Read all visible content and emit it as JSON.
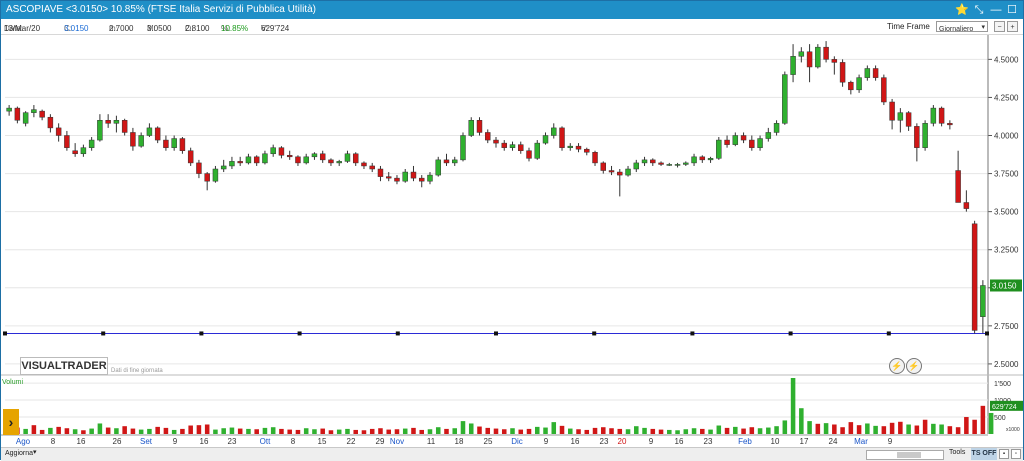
{
  "window": {
    "title": "ASCOPIAVE <3.0150> 10.85%  (FTSE Italia Servizi di Pubblica Utilità)",
    "pin_icon": "star-icon",
    "controls": [
      "⭐",
      "⤡",
      "—",
      "☐",
      "✕"
    ]
  },
  "info": {
    "date_label": "Data:",
    "date": "13/Mar/20",
    "close_label": "C:",
    "close": "3.0150",
    "min_label": "m:",
    "min": "2.7000",
    "max_label": "M:",
    "max": "3.0500",
    "open_label": "O:",
    "open": "2.8100",
    "pct_label": "%:",
    "pct": "10.85%",
    "vol_label": "V:",
    "vol": "629'724",
    "timeframe_label": "Time Frame",
    "timeframe_value": "Giornaliero"
  },
  "chart": {
    "brand": "VISUALTRADER",
    "eod_note": "Dati di fine giornata",
    "volume_label": "Volumi",
    "current_price_label": "3.0150",
    "current_volume_label": "629'724",
    "vol_scale_unit": "x1000",
    "colors": {
      "up": "#2fb02f",
      "down": "#d01616",
      "hline": "#2b2bd6",
      "grid": "#e6e6e6"
    }
  },
  "chart_data": {
    "type": "candlestick",
    "title": "ASCOPIAVE",
    "y_ticks": [
      "4.5000",
      "4.2500",
      "4.0000",
      "3.7500",
      "3.5000",
      "3.2500",
      "3.0000",
      "2.7500",
      "2.5000"
    ],
    "ylim": [
      2.46,
      4.66
    ],
    "horizontal_line": 2.7,
    "vol_ticks": [
      "1'500",
      "1'000",
      "500"
    ],
    "vol_ylim": [
      0,
      1650
    ],
    "x_ticks": [
      {
        "label": "Ago",
        "month": true
      },
      {
        "label": "8"
      },
      {
        "label": "16"
      },
      {
        "label": "26"
      },
      {
        "label": "Set",
        "month": true
      },
      {
        "label": "9"
      },
      {
        "label": "16"
      },
      {
        "label": "23"
      },
      {
        "label": "Ott",
        "month": true
      },
      {
        "label": "8"
      },
      {
        "label": "15"
      },
      {
        "label": "22"
      },
      {
        "label": "29"
      },
      {
        "label": "Nov",
        "month": true
      },
      {
        "label": "11"
      },
      {
        "label": "18"
      },
      {
        "label": "25"
      },
      {
        "label": "Dic",
        "month": true
      },
      {
        "label": "9"
      },
      {
        "label": "16"
      },
      {
        "label": "23"
      },
      {
        "label": "20",
        "red": true
      },
      {
        "label": "9"
      },
      {
        "label": "16"
      },
      {
        "label": "23"
      },
      {
        "label": "Feb",
        "month": true
      },
      {
        "label": "10"
      },
      {
        "label": "17"
      },
      {
        "label": "24"
      },
      {
        "label": "Mar",
        "month": true
      },
      {
        "label": "9"
      }
    ],
    "candles": [
      [
        4.16,
        4.2,
        4.13,
        4.18
      ],
      [
        4.18,
        4.19,
        4.08,
        4.1
      ],
      [
        4.08,
        4.16,
        4.06,
        4.15
      ],
      [
        4.15,
        4.2,
        4.12,
        4.17
      ],
      [
        4.16,
        4.17,
        4.1,
        4.12
      ],
      [
        4.12,
        4.14,
        4.02,
        4.05
      ],
      [
        4.05,
        4.08,
        3.96,
        4.0
      ],
      [
        4.0,
        4.03,
        3.9,
        3.92
      ],
      [
        3.9,
        3.95,
        3.86,
        3.88
      ],
      [
        3.88,
        3.94,
        3.86,
        3.92
      ],
      [
        3.92,
        3.99,
        3.9,
        3.97
      ],
      [
        3.97,
        4.14,
        3.96,
        4.1
      ],
      [
        4.1,
        4.14,
        4.05,
        4.08
      ],
      [
        4.08,
        4.13,
        4.02,
        4.1
      ],
      [
        4.1,
        4.11,
        4.0,
        4.02
      ],
      [
        4.02,
        4.05,
        3.9,
        3.93
      ],
      [
        3.93,
        4.02,
        3.92,
        4.0
      ],
      [
        4.0,
        4.08,
        3.99,
        4.05
      ],
      [
        4.05,
        4.06,
        3.95,
        3.97
      ],
      [
        3.97,
        4.0,
        3.9,
        3.92
      ],
      [
        3.92,
        4.0,
        3.9,
        3.98
      ],
      [
        3.98,
        3.99,
        3.88,
        3.9
      ],
      [
        3.9,
        3.92,
        3.8,
        3.82
      ],
      [
        3.82,
        3.84,
        3.72,
        3.75
      ],
      [
        3.75,
        3.76,
        3.64,
        3.7
      ],
      [
        3.7,
        3.8,
        3.69,
        3.78
      ],
      [
        3.78,
        3.84,
        3.76,
        3.8
      ],
      [
        3.8,
        3.86,
        3.78,
        3.83
      ],
      [
        3.83,
        3.86,
        3.8,
        3.82
      ],
      [
        3.82,
        3.88,
        3.81,
        3.86
      ],
      [
        3.86,
        3.87,
        3.8,
        3.82
      ],
      [
        3.82,
        3.9,
        3.81,
        3.88
      ],
      [
        3.88,
        3.94,
        3.86,
        3.92
      ],
      [
        3.92,
        3.93,
        3.85,
        3.87
      ],
      [
        3.87,
        3.9,
        3.84,
        3.86
      ],
      [
        3.86,
        3.87,
        3.8,
        3.82
      ],
      [
        3.82,
        3.88,
        3.81,
        3.86
      ],
      [
        3.86,
        3.89,
        3.84,
        3.88
      ],
      [
        3.88,
        3.9,
        3.82,
        3.84
      ],
      [
        3.84,
        3.85,
        3.8,
        3.82
      ],
      [
        3.82,
        3.84,
        3.8,
        3.83
      ],
      [
        3.83,
        3.9,
        3.82,
        3.88
      ],
      [
        3.88,
        3.89,
        3.8,
        3.82
      ],
      [
        3.82,
        3.83,
        3.78,
        3.8
      ],
      [
        3.8,
        3.82,
        3.76,
        3.78
      ],
      [
        3.78,
        3.8,
        3.7,
        3.73
      ],
      [
        3.73,
        3.76,
        3.7,
        3.72
      ],
      [
        3.72,
        3.74,
        3.68,
        3.7
      ],
      [
        3.7,
        3.78,
        3.69,
        3.76
      ],
      [
        3.76,
        3.8,
        3.7,
        3.72
      ],
      [
        3.72,
        3.74,
        3.66,
        3.7
      ],
      [
        3.7,
        3.76,
        3.68,
        3.74
      ],
      [
        3.74,
        3.86,
        3.73,
        3.84
      ],
      [
        3.84,
        3.88,
        3.8,
        3.82
      ],
      [
        3.82,
        3.86,
        3.8,
        3.84
      ],
      [
        3.84,
        4.02,
        3.83,
        4.0
      ],
      [
        4.0,
        4.12,
        3.99,
        4.1
      ],
      [
        4.1,
        4.12,
        4.0,
        4.02
      ],
      [
        4.02,
        4.04,
        3.95,
        3.97
      ],
      [
        3.97,
        3.99,
        3.92,
        3.95
      ],
      [
        3.95,
        3.97,
        3.9,
        3.92
      ],
      [
        3.92,
        3.96,
        3.9,
        3.94
      ],
      [
        3.94,
        3.96,
        3.88,
        3.9
      ],
      [
        3.9,
        3.92,
        3.83,
        3.85
      ],
      [
        3.85,
        3.97,
        3.84,
        3.95
      ],
      [
        3.95,
        4.02,
        3.94,
        4.0
      ],
      [
        4.0,
        4.08,
        3.98,
        4.05
      ],
      [
        4.05,
        4.06,
        3.9,
        3.92
      ],
      [
        3.92,
        3.95,
        3.9,
        3.93
      ],
      [
        3.93,
        3.95,
        3.89,
        3.91
      ],
      [
        3.91,
        3.92,
        3.87,
        3.89
      ],
      [
        3.89,
        3.9,
        3.8,
        3.82
      ],
      [
        3.82,
        3.83,
        3.75,
        3.77
      ],
      [
        3.77,
        3.8,
        3.74,
        3.76
      ],
      [
        3.76,
        3.78,
        3.6,
        3.74
      ],
      [
        3.74,
        3.8,
        3.73,
        3.78
      ],
      [
        3.78,
        3.84,
        3.76,
        3.82
      ],
      [
        3.82,
        3.86,
        3.8,
        3.84
      ],
      [
        3.84,
        3.85,
        3.8,
        3.82
      ],
      [
        3.82,
        3.83,
        3.8,
        3.81
      ],
      [
        3.81,
        3.82,
        3.8,
        3.81
      ],
      [
        3.81,
        3.82,
        3.79,
        3.81
      ],
      [
        3.81,
        3.83,
        3.8,
        3.82
      ],
      [
        3.82,
        3.88,
        3.8,
        3.86
      ],
      [
        3.86,
        3.87,
        3.82,
        3.84
      ],
      [
        3.84,
        3.86,
        3.82,
        3.85
      ],
      [
        3.85,
        3.99,
        3.84,
        3.97
      ],
      [
        3.97,
        4.0,
        3.92,
        3.94
      ],
      [
        3.94,
        4.02,
        3.93,
        4.0
      ],
      [
        4.0,
        4.02,
        3.95,
        3.97
      ],
      [
        3.97,
        4.0,
        3.9,
        3.92
      ],
      [
        3.92,
        4.0,
        3.9,
        3.98
      ],
      [
        3.98,
        4.05,
        3.96,
        4.02
      ],
      [
        4.02,
        4.1,
        4.0,
        4.08
      ],
      [
        4.08,
        4.42,
        4.07,
        4.4
      ],
      [
        4.4,
        4.6,
        4.35,
        4.52
      ],
      [
        4.52,
        4.58,
        4.48,
        4.55
      ],
      [
        4.55,
        4.6,
        4.35,
        4.45
      ],
      [
        4.45,
        4.6,
        4.44,
        4.58
      ],
      [
        4.58,
        4.62,
        4.48,
        4.5
      ],
      [
        4.5,
        4.52,
        4.4,
        4.48
      ],
      [
        4.48,
        4.5,
        4.32,
        4.35
      ],
      [
        4.35,
        4.36,
        4.27,
        4.3
      ],
      [
        4.3,
        4.4,
        4.28,
        4.38
      ],
      [
        4.38,
        4.46,
        4.36,
        4.44
      ],
      [
        4.44,
        4.46,
        4.36,
        4.38
      ],
      [
        4.38,
        4.4,
        4.2,
        4.22
      ],
      [
        4.22,
        4.24,
        4.04,
        4.1
      ],
      [
        4.1,
        4.18,
        4.02,
        4.15
      ],
      [
        4.15,
        4.16,
        4.03,
        4.06
      ],
      [
        4.06,
        4.08,
        3.83,
        3.92
      ],
      [
        3.92,
        4.1,
        3.9,
        4.08
      ],
      [
        4.08,
        4.2,
        4.06,
        4.18
      ],
      [
        4.18,
        4.19,
        4.06,
        4.08
      ],
      [
        4.08,
        4.1,
        4.04,
        4.07
      ],
      [
        3.77,
        3.9,
        3.6,
        3.56
      ],
      [
        3.56,
        3.64,
        3.5,
        3.52
      ],
      [
        3.42,
        3.44,
        2.7,
        2.72
      ],
      [
        2.81,
        3.05,
        2.7,
        3.015
      ]
    ],
    "volumes": [
      [
        240,
        1
      ],
      [
        190,
        0
      ],
      [
        150,
        1
      ],
      [
        260,
        0
      ],
      [
        120,
        0
      ],
      [
        180,
        1
      ],
      [
        210,
        0
      ],
      [
        170,
        0
      ],
      [
        140,
        1
      ],
      [
        110,
        0
      ],
      [
        160,
        1
      ],
      [
        310,
        1
      ],
      [
        190,
        0
      ],
      [
        170,
        1
      ],
      [
        230,
        0
      ],
      [
        160,
        0
      ],
      [
        130,
        1
      ],
      [
        150,
        1
      ],
      [
        210,
        0
      ],
      [
        180,
        0
      ],
      [
        120,
        1
      ],
      [
        150,
        0
      ],
      [
        250,
        0
      ],
      [
        260,
        0
      ],
      [
        280,
        0
      ],
      [
        130,
        1
      ],
      [
        170,
        1
      ],
      [
        190,
        1
      ],
      [
        160,
        0
      ],
      [
        150,
        1
      ],
      [
        140,
        0
      ],
      [
        180,
        1
      ],
      [
        200,
        1
      ],
      [
        150,
        0
      ],
      [
        130,
        0
      ],
      [
        120,
        0
      ],
      [
        170,
        1
      ],
      [
        140,
        1
      ],
      [
        160,
        0
      ],
      [
        110,
        0
      ],
      [
        130,
        1
      ],
      [
        150,
        1
      ],
      [
        120,
        0
      ],
      [
        110,
        0
      ],
      [
        150,
        0
      ],
      [
        170,
        0
      ],
      [
        130,
        0
      ],
      [
        140,
        0
      ],
      [
        160,
        1
      ],
      [
        180,
        0
      ],
      [
        120,
        0
      ],
      [
        140,
        1
      ],
      [
        200,
        1
      ],
      [
        150,
        0
      ],
      [
        170,
        1
      ],
      [
        380,
        1
      ],
      [
        310,
        1
      ],
      [
        220,
        0
      ],
      [
        180,
        0
      ],
      [
        160,
        0
      ],
      [
        140,
        0
      ],
      [
        170,
        1
      ],
      [
        130,
        0
      ],
      [
        150,
        0
      ],
      [
        210,
        1
      ],
      [
        190,
        1
      ],
      [
        350,
        1
      ],
      [
        240,
        0
      ],
      [
        160,
        1
      ],
      [
        140,
        0
      ],
      [
        120,
        0
      ],
      [
        180,
        0
      ],
      [
        200,
        0
      ],
      [
        170,
        0
      ],
      [
        150,
        0
      ],
      [
        140,
        1
      ],
      [
        230,
        1
      ],
      [
        180,
        1
      ],
      [
        150,
        0
      ],
      [
        130,
        0
      ],
      [
        120,
        1
      ],
      [
        110,
        1
      ],
      [
        140,
        1
      ],
      [
        170,
        1
      ],
      [
        150,
        0
      ],
      [
        130,
        1
      ],
      [
        250,
        1
      ],
      [
        180,
        0
      ],
      [
        210,
        1
      ],
      [
        160,
        0
      ],
      [
        200,
        0
      ],
      [
        170,
        1
      ],
      [
        190,
        1
      ],
      [
        230,
        1
      ],
      [
        400,
        1
      ],
      [
        1650,
        1
      ],
      [
        760,
        1
      ],
      [
        380,
        1
      ],
      [
        300,
        0
      ],
      [
        320,
        1
      ],
      [
        280,
        0
      ],
      [
        200,
        0
      ],
      [
        350,
        0
      ],
      [
        260,
        0
      ],
      [
        310,
        1
      ],
      [
        240,
        1
      ],
      [
        230,
        0
      ],
      [
        330,
        0
      ],
      [
        360,
        0
      ],
      [
        280,
        1
      ],
      [
        250,
        0
      ],
      [
        420,
        0
      ],
      [
        300,
        1
      ],
      [
        280,
        1
      ],
      [
        230,
        0
      ],
      [
        200,
        0
      ],
      [
        500,
        0
      ],
      [
        420,
        0
      ],
      [
        830,
        0
      ],
      [
        620,
        1
      ]
    ]
  }
}
